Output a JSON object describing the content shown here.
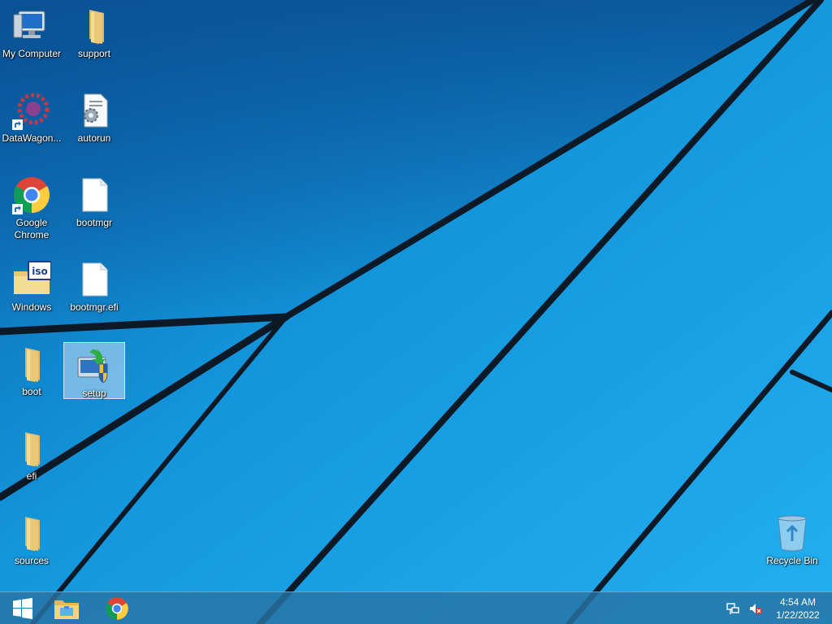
{
  "desktop": {
    "icons": [
      {
        "id": "my-computer",
        "label": "My Computer"
      },
      {
        "id": "support",
        "label": "support"
      },
      {
        "id": "datawagon",
        "label": "DataWagon..."
      },
      {
        "id": "autorun",
        "label": "autorun"
      },
      {
        "id": "google-chrome",
        "label": "Google Chrome"
      },
      {
        "id": "bootmgr",
        "label": "bootmgr"
      },
      {
        "id": "windows-iso",
        "label": "Windows"
      },
      {
        "id": "bootmgr-efi",
        "label": "bootmgr.efi"
      },
      {
        "id": "boot",
        "label": "boot"
      },
      {
        "id": "setup",
        "label": "setup"
      },
      {
        "id": "efi",
        "label": "efi"
      },
      {
        "id": "sources",
        "label": "sources"
      },
      {
        "id": "recycle-bin",
        "label": "Recycle Bin"
      }
    ],
    "selected_icon": "setup"
  },
  "taskbar": {
    "pinned": [
      "start-button",
      "file-explorer-icon",
      "chrome-icon"
    ],
    "tray": {
      "icons": [
        "network-icon",
        "volume-muted-icon"
      ],
      "time": "4:54 AM",
      "date": "1/22/2022"
    }
  },
  "colors": {
    "wallpaper_blue": "#1aa0e6",
    "taskbar": "#2873a5",
    "selection": "#c8e1f5"
  }
}
